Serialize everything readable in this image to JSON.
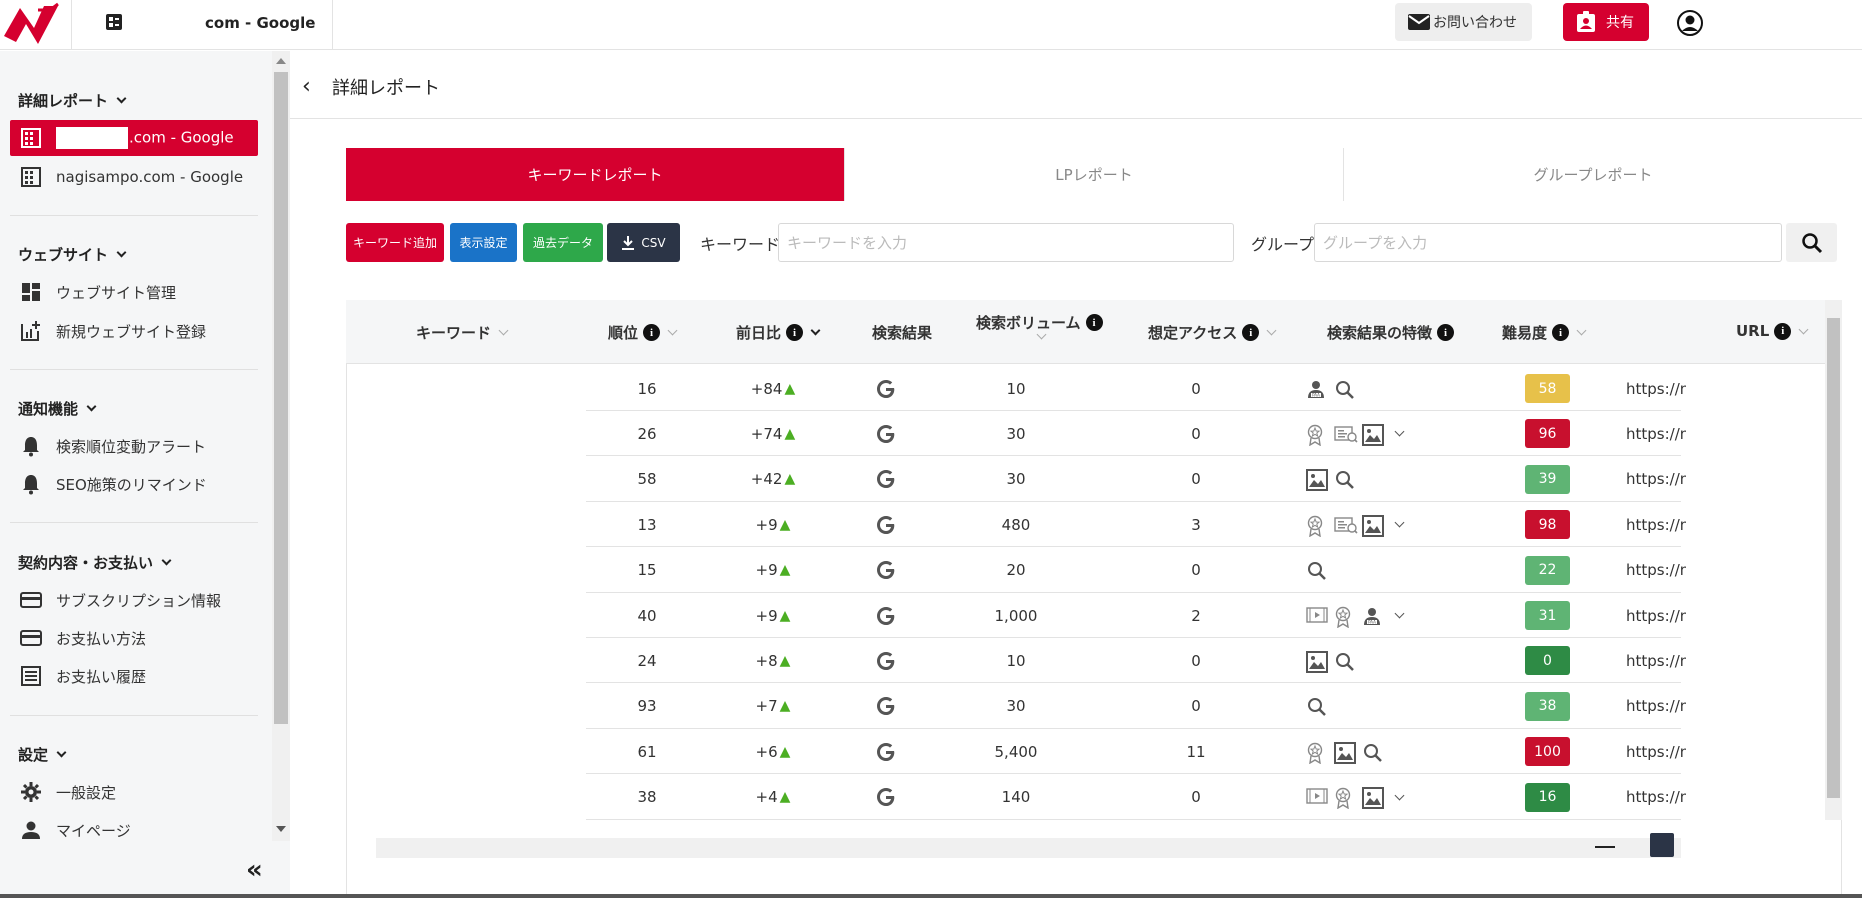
{
  "topbar": {
    "site_title": "com - Google",
    "contact_label": "お問い合わせ",
    "share_label": "共有"
  },
  "sidebar": {
    "sections": [
      {
        "title": "詳細レポート",
        "items": [
          {
            "label": ".com - Google",
            "icon": "building-icon",
            "active": true
          },
          {
            "label": "nagisampo.com - Google",
            "icon": "building-icon",
            "active": false
          }
        ]
      },
      {
        "title": "ウェブサイト",
        "items": [
          {
            "label": "ウェブサイト管理",
            "icon": "dashboard-icon"
          },
          {
            "label": "新規ウェブサイト登録",
            "icon": "add-chart-icon"
          }
        ]
      },
      {
        "title": "通知機能",
        "items": [
          {
            "label": "検索順位変動アラート",
            "icon": "bell-icon"
          },
          {
            "label": "SEO施策のリマインド",
            "icon": "bell-icon"
          }
        ]
      },
      {
        "title": "契約内容・お支払い",
        "items": [
          {
            "label": "サブスクリプション情報",
            "icon": "card-icon"
          },
          {
            "label": "お支払い方法",
            "icon": "card-icon"
          },
          {
            "label": "お支払い履歴",
            "icon": "receipt-icon"
          }
        ]
      },
      {
        "title": "設定",
        "items": [
          {
            "label": "一般設定",
            "icon": "gear-icon"
          },
          {
            "label": "マイページ",
            "icon": "person-icon"
          }
        ]
      }
    ],
    "collapse_glyph": "«"
  },
  "page": {
    "back_glyph": "‹",
    "title": "詳細レポート"
  },
  "tabs": [
    "キーワードレポート",
    "LPレポート",
    "グループレポート"
  ],
  "toolbar": {
    "add_keyword": "キーワード追加",
    "display_settings": "表示設定",
    "past_data": "過去データ",
    "csv": "CSV",
    "keyword_label": "キーワード",
    "keyword_placeholder": "キーワードを入力",
    "group_label": "グループ",
    "group_placeholder": "グループを入力"
  },
  "colors": {
    "brand": "#d5002f",
    "blue": "#1a73c8",
    "green": "#2ea84a",
    "dark": "#2b3446",
    "up": "#4cae23"
  },
  "table": {
    "headers": {
      "keyword": "キーワード",
      "rank": "順位",
      "diff": "前日比",
      "result": "検索結果",
      "volume": "検索ボリューム",
      "access": "想定アクセス",
      "features": "検索結果の特徴",
      "difficulty": "難易度",
      "url": "URL"
    },
    "rows": [
      {
        "rank": "16",
        "diff": "+84",
        "volume": "10",
        "access": "0",
        "features": [
          "paa-icon",
          "search-icon"
        ],
        "more": false,
        "difficulty": "58",
        "diff_color": "#e7c14a",
        "url": "https://n"
      },
      {
        "rank": "26",
        "diff": "+74",
        "volume": "30",
        "access": "0",
        "features": [
          "award-icon",
          "featured-snippet-icon",
          "image-icon"
        ],
        "more": true,
        "difficulty": "96",
        "diff_color": "#c8102e",
        "url": "https://n"
      },
      {
        "rank": "58",
        "diff": "+42",
        "volume": "30",
        "access": "0",
        "features": [
          "image-icon",
          "search-icon"
        ],
        "more": false,
        "difficulty": "39",
        "diff_color": "#5fb474",
        "url": "https://n"
      },
      {
        "rank": "13",
        "diff": "+9",
        "volume": "480",
        "access": "3",
        "features": [
          "award-icon",
          "featured-snippet-icon",
          "image-icon"
        ],
        "more": true,
        "difficulty": "98",
        "diff_color": "#c8102e",
        "url": "https://n"
      },
      {
        "rank": "15",
        "diff": "+9",
        "volume": "20",
        "access": "0",
        "features": [
          "search-icon"
        ],
        "more": false,
        "difficulty": "22",
        "diff_color": "#5fb474",
        "url": "https://n"
      },
      {
        "rank": "40",
        "diff": "+9",
        "volume": "1,000",
        "access": "2",
        "features": [
          "video-icon",
          "award-icon",
          "paa-icon"
        ],
        "more": true,
        "difficulty": "31",
        "diff_color": "#5fb474",
        "url": "https://n"
      },
      {
        "rank": "24",
        "diff": "+8",
        "volume": "10",
        "access": "0",
        "features": [
          "image-icon",
          "search-icon"
        ],
        "more": false,
        "difficulty": "0",
        "diff_color": "#2e8b45",
        "url": "https://n"
      },
      {
        "rank": "93",
        "diff": "+7",
        "volume": "30",
        "access": "0",
        "features": [
          "search-icon"
        ],
        "more": false,
        "difficulty": "38",
        "diff_color": "#5fb474",
        "url": "https://n"
      },
      {
        "rank": "61",
        "diff": "+6",
        "volume": "5,400",
        "access": "11",
        "features": [
          "award-icon",
          "image-icon",
          "search-icon"
        ],
        "more": false,
        "difficulty": "100",
        "diff_color": "#c8102e",
        "url": "https://n"
      },
      {
        "rank": "38",
        "diff": "+4",
        "volume": "140",
        "access": "0",
        "features": [
          "video-icon",
          "award-icon",
          "image-icon"
        ],
        "more": true,
        "difficulty": "16",
        "diff_color": "#2e8b45",
        "url": "https://n"
      }
    ]
  }
}
